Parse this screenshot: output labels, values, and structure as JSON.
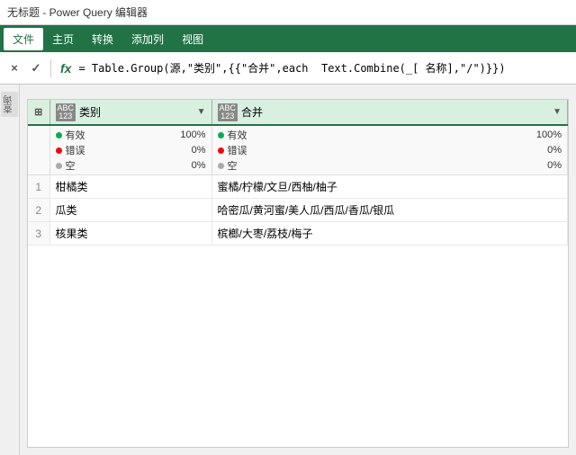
{
  "titlebar": {
    "title": "无标题 - Power Query 编辑器"
  },
  "menubar": {
    "items": [
      {
        "label": "文件",
        "active": false
      },
      {
        "label": "主页",
        "active": false
      },
      {
        "label": "转换",
        "active": false
      },
      {
        "label": "添加列",
        "active": false
      },
      {
        "label": "视图",
        "active": false
      }
    ]
  },
  "formulabar": {
    "cancel_label": "×",
    "confirm_label": "✓",
    "fx_label": "fx",
    "formula": "= Table.Group(源,\"类别\",{{\"合并\",each  Text.Combine(_[ 名称],\"/\")}})"
  },
  "table": {
    "corner_icon": "⊞",
    "columns": [
      {
        "type_line1": "ABC",
        "type_line2": "123",
        "name": "类别",
        "stats": [
          {
            "color": "#00b050",
            "label": "有效",
            "value": "100%"
          },
          {
            "color": "#ff0000",
            "label": "错误",
            "value": "0%"
          },
          {
            "color": "#aaaaaa",
            "label": "空",
            "value": "0%"
          }
        ]
      },
      {
        "type_line1": "ABC",
        "type_line2": "123",
        "name": "合并",
        "stats": [
          {
            "color": "#00b050",
            "label": "有效",
            "value": "100%"
          },
          {
            "color": "#ff0000",
            "label": "错误",
            "value": "0%"
          },
          {
            "color": "#aaaaaa",
            "label": "空",
            "value": "0%"
          }
        ]
      }
    ],
    "rows": [
      {
        "num": 1,
        "col1": "柑橘类",
        "col2": "蜜橘/柠檬/文旦/西柚/柚子"
      },
      {
        "num": 2,
        "col1": "瓜类",
        "col2": "哈密瓜/黄河蜜/美人瓜/西瓜/香瓜/银瓜"
      },
      {
        "num": 3,
        "col1": "核果类",
        "col2": "槟榔/大枣/荔枝/梅子"
      }
    ]
  },
  "sidebar": {
    "icon1": "查",
    "icon2": "询"
  }
}
